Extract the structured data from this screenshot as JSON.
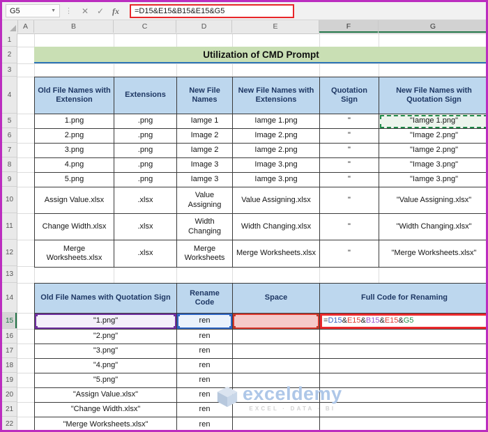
{
  "formula_bar": {
    "name_box": "G5",
    "cancel": "✕",
    "enter": "✓",
    "fx": "fx",
    "formula": "=D15&E15&B15&E15&G5",
    "formula_parts": [
      {
        "text": "=",
        "color": "#202020"
      },
      {
        "text": "D15",
        "color": "#3b63c4"
      },
      {
        "text": "&",
        "color": "#202020"
      },
      {
        "text": "E15",
        "color": "#de3b31"
      },
      {
        "text": "&",
        "color": "#202020"
      },
      {
        "text": "B15",
        "color": "#9a57cf"
      },
      {
        "text": "&",
        "color": "#202020"
      },
      {
        "text": "E15",
        "color": "#de3b31"
      },
      {
        "text": "&",
        "color": "#202020"
      },
      {
        "text": "G5",
        "color": "#27934f"
      }
    ]
  },
  "grid": {
    "column_headers": [
      "A",
      "B",
      "C",
      "D",
      "E",
      "F",
      "G"
    ],
    "highlighted_columns": [
      "F",
      "G"
    ],
    "row_numbers": [
      "1",
      "2",
      "3",
      "4",
      "5",
      "6",
      "7",
      "8",
      "9",
      "10",
      "11",
      "12",
      "13",
      "14",
      "15",
      "16",
      "17",
      "18",
      "19",
      "20",
      "21",
      "22"
    ],
    "highlighted_row": "15"
  },
  "title": {
    "text": "Utilization of CMD Prompt"
  },
  "table1": {
    "headers": [
      "Old File Names with Extension",
      "Extensions",
      "New File Names",
      "New File Names with Extensions",
      "Quotation Sign",
      "New File Names with Quotation Sign"
    ],
    "rows": [
      [
        "1.png",
        ".png",
        "Iamge 1",
        "Iamge 1.png",
        "\"",
        "\"Iamge 1.png\""
      ],
      [
        "2.png",
        ".png",
        "Image 2",
        "Image 2.png",
        "\"",
        "\"Image 2.png\""
      ],
      [
        "3.png",
        ".png",
        "Iamge 2",
        "Iamge 2.png",
        "\"",
        "\"Iamge 2.png\""
      ],
      [
        "4.png",
        ".png",
        "Image 3",
        "Image 3.png",
        "\"",
        "\"Image 3.png\""
      ],
      [
        "5.png",
        ".png",
        "Iamge 3",
        "Iamge 3.png",
        "\"",
        "\"Iamge 3.png\""
      ],
      [
        "Assign Value.xlsx",
        ".xlsx",
        "Value Assigning",
        "Value Assigning.xlsx",
        "\"",
        "\"Value Assigning.xlsx\""
      ],
      [
        "Change Width.xlsx",
        ".xlsx",
        "Width Changing",
        "Width Changing.xlsx",
        "\"",
        "\"Width Changing.xlsx\""
      ],
      [
        "Merge Worksheets.xlsx",
        ".xlsx",
        "Merge Worksheets",
        "Merge Worksheets.xlsx",
        "\"",
        "\"Merge Worksheets.xlsx\""
      ]
    ]
  },
  "table2": {
    "headers": [
      "Old File Names with Quotation Sign",
      "Rename Code",
      "Space",
      "Full Code for Renaming"
    ],
    "rows": [
      [
        "\"1.png\"",
        "ren",
        " ",
        "=D15&E15&B15&E15&G5"
      ],
      [
        "\"2.png\"",
        "ren",
        "",
        ""
      ],
      [
        "\"3.png\"",
        "ren",
        "",
        ""
      ],
      [
        "\"4.png\"",
        "ren",
        "",
        ""
      ],
      [
        "\"5.png\"",
        "ren",
        "",
        ""
      ],
      [
        "\"Assign Value.xlsx\"",
        "ren",
        "",
        ""
      ],
      [
        "\"Change Width.xlsx\"",
        "ren",
        "",
        ""
      ],
      [
        "\"Merge Worksheets.xlsx\"",
        "ren",
        "",
        ""
      ]
    ]
  },
  "watermark": {
    "brand": "exceldemy",
    "tagline": "EXCEL · DATA · BI"
  }
}
